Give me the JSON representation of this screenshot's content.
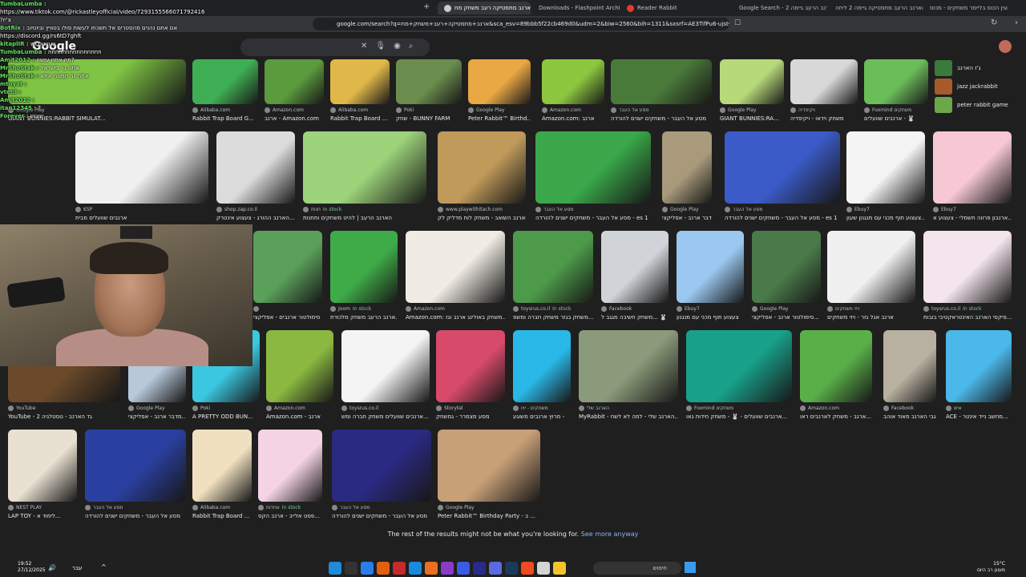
{
  "browser": {
    "tabs": [
      {
        "label": "ארנב מתמטיקה רעב משחק מח",
        "active": true
      },
      {
        "label": "Downloads - Flashpoint Archive",
        "active": false
      },
      {
        "label": "Reader Rabbit",
        "active": false
      },
      {
        "label": "Google Search - הארנב הרעב גיימה 2",
        "active": false
      },
      {
        "label": "הארנב הרעב מתמטיקה גיימה 2 ליחה",
        "active": false
      },
      {
        "label": "וגין הכוס בליימר משחקים - מכוס",
        "active": false
      }
    ],
    "url": "google.com/search?q=ארנב+מתמטיקה+רעב+משחק+מח&sca_esv=89bbb5f22cb469d0&udm=2&biw=2560&bih=1311&sxsrf=AE3TifPu6-ujstyrn..."
  },
  "google": {
    "logo": "Google"
  },
  "chat": [
    {
      "user": "TumbaLumba :",
      "text": ""
    },
    {
      "user": "",
      "text": "https://www.tiktok.com/@rickastleyofficial/video/7293155566071792416"
    },
    {
      "user": "",
      "text": "?צ'יז"
    },
    {
      "user": "BotRix :",
      "text": "אם אתם נהנים מהסטרים אל תשכחו לעשות פולו בטוויץ וביוטיוב"
    },
    {
      "user": "",
      "text": "https://discord.gg/rs6tD7ghft"
    },
    {
      "user": "kitaplIR :",
      "text": "wcouuuu"
    },
    {
      "user": "TumbaLumba :",
      "text": "nnnnnnnnnnnnnnn"
    },
    {
      "user": "Amit2012 :",
      "text": "מה אתה עושה?"
    },
    {
      "user": "MrShoStak :",
      "text": "אתה גר בישראל"
    },
    {
      "user": "MrShoStak :",
      "text": "אתה גר תמונה אתא"
    },
    {
      "user": "mtoyat :",
      "text": ""
    },
    {
      "user": "vtetd :",
      "text": ""
    },
    {
      "user": "Amit2012 :",
      "text": ""
    },
    {
      "user": "itan12345 :",
      "text": "?"
    },
    {
      "user": "Forever :",
      "text": "שוגוש"
    }
  ],
  "related": [
    {
      "label": "ג'ז הארנב"
    },
    {
      "label": "jazz jackrabbit"
    },
    {
      "label": "peter rabbit game"
    }
  ],
  "results_footer": {
    "text": "The rest of the results might not be what you're looking for.",
    "link": "See more anyway"
  },
  "taskbar": {
    "time": "19:52",
    "date": "27/12/2025",
    "search_placeholder": "חיפוש",
    "lang": "עבר",
    "temp": "15°C",
    "weather": "מעונן רב היום"
  },
  "row1": [
    {
      "source": "Google Play",
      "title": "GIANT BUNNIES:RABBIT SIMULAT...",
      "color": "#7fc443"
    },
    {
      "source": "Alibaba.com",
      "title": "Rabbit Trap Board G...",
      "color": "#3fae54"
    },
    {
      "source": "Amazon.com",
      "title": "ארנב - Amazon.com",
      "color": "#5b9a3d"
    },
    {
      "source": "Alibaba.com",
      "title": "Rabbit Trap Board ...",
      "color": "#e0b84a"
    },
    {
      "source": "Poki",
      "title": "שחק - BUNNY FARM",
      "color": "#6b8e4e"
    },
    {
      "source": "Google Play",
      "title": "Peter Rabbit™ Birthd...",
      "color": "#e8a844"
    },
    {
      "source": "Amazon.com",
      "title": "Amazon.com: ארנב",
      "color": "#8cc63f"
    },
    {
      "source": "מסע אל העבר",
      "title": "מסע אל העבר - משחקים ישנים להורדה",
      "color": "#4a7a3a"
    },
    {
      "source": "Google Play",
      "title": "GIANT BUNNIES:RA...",
      "color": "#b7d97a"
    },
    {
      "source": "ויקיפדיה",
      "title": "משחק וידאו - ויקיפדיה",
      "color": "#d8d8d8"
    },
    {
      "source": "Foxmind משחקים",
      "title": "ארנבים שוועלים - 🐰",
      "color": "#6bbd5a"
    }
  ],
  "row2": [
    {
      "source": "KSP",
      "title": "ארנבים שוועלים מבית",
      "color": "#f0f0f0"
    },
    {
      "source": "shop.zap.co.il",
      "title": "הארנב ההורג - צעצוע אינטרק...",
      "color": "#dcdcdc"
    },
    {
      "source": "חנות",
      "title": "הארנב הרעב | להיט משחקים ותחנות",
      "color": "#9dd37a",
      "stock": "In stock"
    },
    {
      "source": "www.playwithitach.com",
      "title": "הארנב השואב - משחק לוח מדליק לק...",
      "color": "#c09a5a"
    },
    {
      "source": "מסע אל העבר",
      "title": "מסע אל העבר - משחקים ישנים להורדה - es 1",
      "color": "#3aa84a"
    },
    {
      "source": "Google Play",
      "title": "מדבר ארנב - אפליקצי...",
      "color": "#a89a7a"
    },
    {
      "source": "מסע אל העבר",
      "title": "מסע אל העבר - משחקים ישנים להורדה - es 1",
      "color": "#3b5bc8"
    },
    {
      "source": "Ebuy7",
      "title": "צעצוע תוף מכני עם מנגנון שעון...",
      "color": "#f4f4f4"
    },
    {
      "source": "Ebuy7",
      "title": "ארנבון פרווה חשמלי - צעצוע א...",
      "color": "#f6c8d4"
    }
  ],
  "row3": [
    {
      "source": "",
      "title": "סימולטור ארנבים - אפליקצי",
      "color": "#5aa05a"
    },
    {
      "source": "Joom",
      "title": "ארנב הרעב משחק מלכודת...",
      "color": "#3faa48",
      "stock": "In stock"
    },
    {
      "source": "Amazon.com",
      "title": "Amazon.com: משחק באולינג ארנב וגז...",
      "color": "#f0ece4"
    },
    {
      "source": "toysrus.co.il",
      "title": "משחק בגזר משחק חברה ומשפ...",
      "color": "#4c9a4a",
      "stock": "In stock"
    },
    {
      "source": "Facebook",
      "title": "משחק חשיבה מגגב ל... 🐰",
      "color": "#d0d4d8"
    },
    {
      "source": "Ebuy7",
      "title": "צעצוע תוף מכני עם מנגנון",
      "color": "#9ac8f0"
    },
    {
      "source": "Google Play",
      "title": "סימולטור ארנב - אפליקצי...",
      "color": "#4a7a4a"
    },
    {
      "source": "ויזי משחקים",
      "title": "ארנב אגל גזר - ויזי משחקים",
      "color": "#f0f0f0"
    },
    {
      "source": "toysrus.co.il",
      "title": "פיקסי הארנב האינטראקטיבי בובות...",
      "color": "#f4e4ec",
      "stock": "In stock"
    }
  ],
  "row4": [
    {
      "source": "YouTube",
      "title": "YouTube - 2 גד הארנב - נוסטלגיה",
      "color": "#6a4a2a"
    },
    {
      "source": "Google Play",
      "title": "מדבר ארנב - אפליקצי...",
      "color": "#b8c8d8"
    },
    {
      "source": "Poki",
      "title": "A PRETTY ODD BUN...",
      "color": "#3ac8e0"
    },
    {
      "source": "Amazon.com",
      "title": "Amazon.com - ארנב",
      "color": "#8ab840"
    },
    {
      "source": "toysrus.co.il",
      "title": "ארנבים שוועלים משחק חברה ומש...",
      "color": "#f4f4f4"
    },
    {
      "source": "Storytel",
      "title": "מסע מצמרר - גמשחק",
      "color": "#d84a6a"
    },
    {
      "source": "משחקים - יויו",
      "title": "מרוץ ארנבים משוגע -",
      "color": "#2ab8e8"
    },
    {
      "source": "הארנב שלי",
      "title": "MyRabbit - הארנב שלי - למה לא לשח...",
      "color": "#8a9a7a"
    },
    {
      "source": "Foxmind משחקים",
      "title": "ארנבים שוועלים - 🐰 - משחק חידות גאו...",
      "color": "#18a08a"
    },
    {
      "source": "Amazon.com",
      "title": "ארנב - משחק לארנבים ראו...",
      "color": "#5ab048"
    },
    {
      "source": "Facebook",
      "title": "גבי הארנב מאוד אוהב...",
      "color": "#b8b0a0"
    },
    {
      "source": "איש",
      "title": "ACE - מחשב נייד אינטר...",
      "color": "#4ab8e8"
    }
  ],
  "row5": [
    {
      "source": "NEST PLAY",
      "title": "LAP TOY - לימוד א...",
      "color": "#e8e0d0"
    },
    {
      "source": "מסע אל העבר",
      "title": "מסע אל העבר - משחקים ישנים להורדה",
      "color": "#2a40a0"
    },
    {
      "source": "Alibaba.com",
      "title": "Rabbit Trap Board ...",
      "color": "#f0e0c0"
    },
    {
      "source": "אחדות",
      "title": "פסט אלייב - ארנב הקס...",
      "color": "#f4d4e4",
      "stock": "In stock"
    },
    {
      "source": "מסע אל העבר",
      "title": "מסע אל העבר - משחקים ישנים להורדה",
      "color": "#2a2a80"
    },
    {
      "source": "Google Play",
      "title": "Peter Rabbit™ Birthday Party - ב ...",
      "color": "#c8a078"
    }
  ]
}
